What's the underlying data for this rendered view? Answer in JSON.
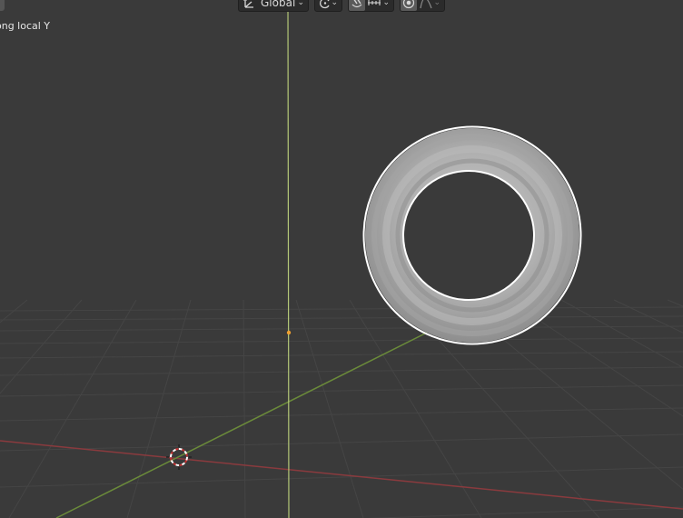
{
  "viewport": {
    "operation_hint": "ong local Y",
    "background": "#3a3a3a"
  },
  "header": {
    "transform_orientation": {
      "value": "Global",
      "icon": "orientation-axes-icon"
    },
    "pivot_point": {
      "icon": "pivot-point-icon"
    },
    "snap": {
      "toggle_icon": "magnet-icon",
      "element_icon": "snap-increment-icon"
    },
    "proportional_editing": {
      "toggle_icon": "proportional-editing-icon",
      "falloff_icon": "falloff-curve-icon"
    }
  },
  "scene": {
    "object": "torus",
    "cursor_icon": "3d-cursor-icon",
    "colors": {
      "x_axis": "#8a3a3e",
      "y_axis": "#6a8a3a",
      "constraint_axis": "#b4c878",
      "selection_outline": "#ffffff",
      "origin_dot": "#f0a030"
    }
  }
}
